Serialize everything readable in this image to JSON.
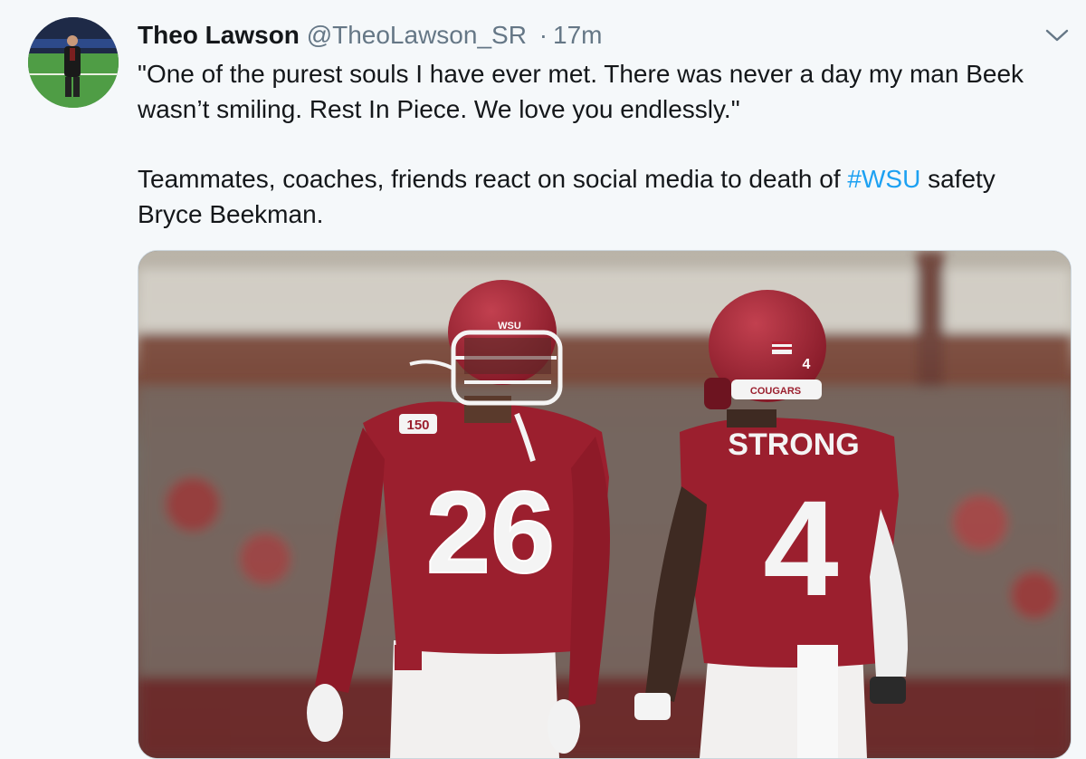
{
  "tweet": {
    "author_name": "Theo Lawson",
    "author_handle": "@TheoLawson_SR",
    "separator": "·",
    "timestamp": "17m",
    "text_line1": "\"One of the purest souls I have ever met. There was never a day my man Beek wasn’t smiling. Rest In Piece. We love you endlessly.\"",
    "text_line2_prefix": "Teammates, coaches, friends react on social media to death of ",
    "hashtag": "#WSU",
    "text_line2_suffix": " safety Bryce Beekman.",
    "menu_icon": "chevron-down-icon"
  },
  "media": {
    "player_left": {
      "number": "26",
      "patch": "150",
      "helmet_logo": "WSU"
    },
    "player_right": {
      "name": "STRONG",
      "number": "4",
      "helmet_number": "4",
      "helmet_text": "COUGARS"
    }
  },
  "colors": {
    "background": "#f5f8fa",
    "text": "#14171a",
    "secondary_text": "#657786",
    "link": "#1da1f2",
    "jersey_crimson": "#9b1f2e"
  }
}
